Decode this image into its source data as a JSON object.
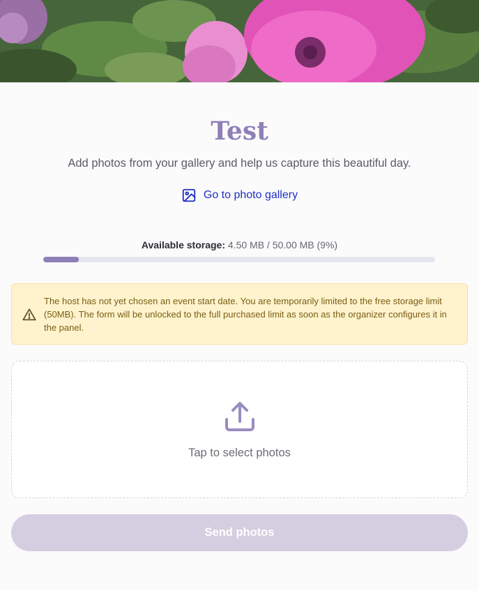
{
  "event": {
    "title": "Test",
    "subtitle": "Add photos from your gallery and help us capture this beautiful day."
  },
  "gallery_link": {
    "label": "Go to photo gallery",
    "icon": "image-icon"
  },
  "storage": {
    "label": "Available storage:",
    "value": "4.50 MB / 50.00 MB (9%)",
    "used_fraction": 0.09
  },
  "notice": {
    "icon": "warning-icon",
    "text": "The host has not yet chosen an event start date. You are temporarily limited to the free storage limit (50MB). The form will be unlocked to the full purchased limit as soon as the organizer configures it in the panel."
  },
  "dropzone": {
    "icon": "upload-icon",
    "hint": "Tap to select photos"
  },
  "send_button": {
    "label": "Send photos",
    "disabled": true
  },
  "colors": {
    "accent": "#8e7fb7",
    "link": "#1f2fc4",
    "notice_bg": "#fff3cd",
    "notice_text": "#7a5d14",
    "button_disabled": "#d5cde0"
  }
}
